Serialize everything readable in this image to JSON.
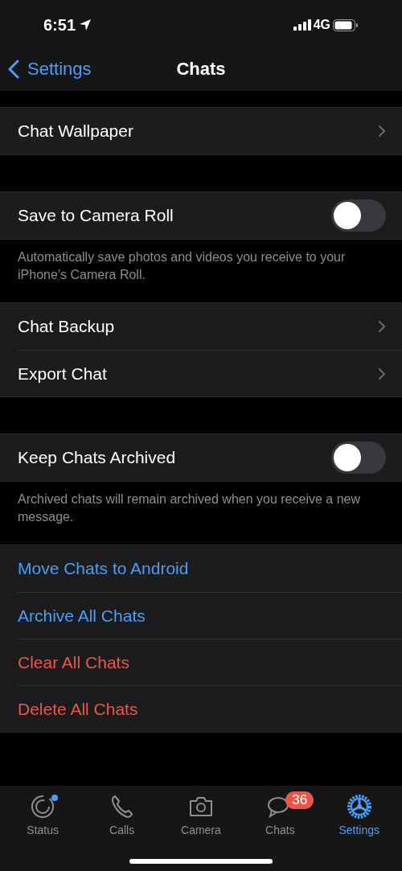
{
  "status_bar": {
    "time": "6:51",
    "network": "4G"
  },
  "nav": {
    "back": "Settings",
    "title": "Chats"
  },
  "sections": [
    {
      "rows": [
        {
          "kind": "disclosure",
          "label": "Chat Wallpaper"
        }
      ]
    },
    {
      "rows": [
        {
          "kind": "toggle",
          "label": "Save to Camera Roll",
          "on": false
        }
      ],
      "footer": "Automatically save photos and videos you receive to your iPhone’s Camera Roll."
    },
    {
      "rows": [
        {
          "kind": "disclosure",
          "label": "Chat Backup"
        },
        {
          "kind": "disclosure",
          "label": "Export Chat"
        }
      ]
    },
    {
      "rows": [
        {
          "kind": "toggle",
          "label": "Keep Chats Archived",
          "on": false
        }
      ],
      "footer": "Archived chats will remain archived when you receive a new message."
    },
    {
      "rows": [
        {
          "kind": "action",
          "label": "Move Chats to Android",
          "color": "#4a9ef5"
        },
        {
          "kind": "action",
          "label": "Archive All Chats",
          "color": "#4a9ef5"
        },
        {
          "kind": "action",
          "label": "Clear All Chats",
          "color": "#e9574a"
        },
        {
          "kind": "action",
          "label": "Delete All Chats",
          "color": "#e9574a"
        }
      ]
    }
  ],
  "tab_bar": [
    {
      "kind": "status",
      "label": "Status",
      "selected": false,
      "dot": true
    },
    {
      "kind": "calls",
      "label": "Calls",
      "selected": false
    },
    {
      "kind": "camera",
      "label": "Camera",
      "selected": false
    },
    {
      "kind": "chats",
      "label": "Chats",
      "selected": false,
      "badge": "36"
    },
    {
      "kind": "settings",
      "label": "Settings",
      "selected": true
    }
  ]
}
